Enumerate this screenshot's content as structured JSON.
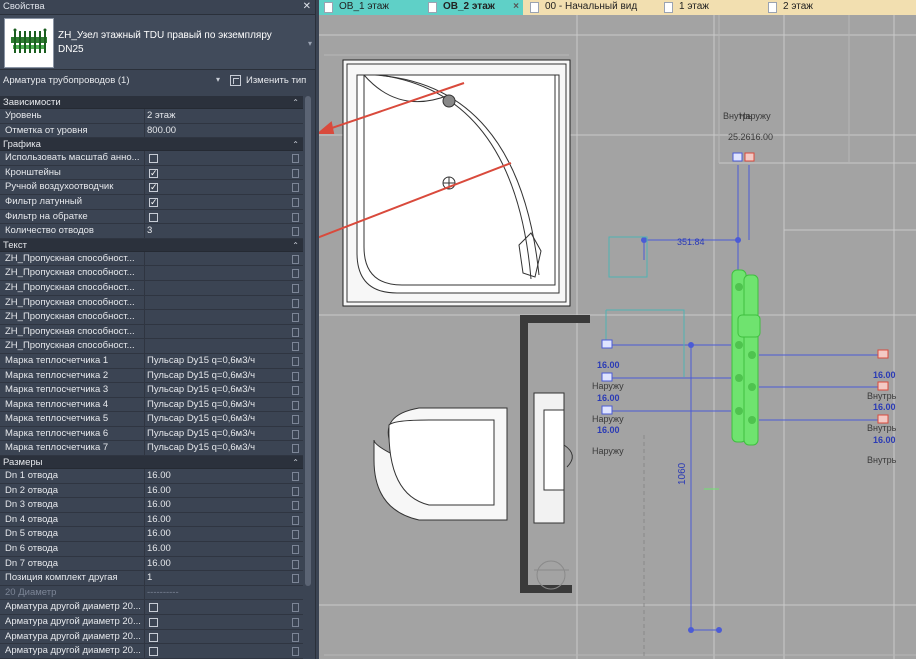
{
  "properties_panel": {
    "title": "Свойства",
    "close_glyph": "✕",
    "type_name_line1": "ZH_Узел этажный TDU правый по экземпляру",
    "type_name_line2": "DN25",
    "category_selector": "Арматура трубопроводов (1)",
    "edit_type_label": "Изменить тип",
    "sections": {
      "dependencies": {
        "title": "Зависимости",
        "rows": [
          {
            "label": "Уровень",
            "value": "2 этаж"
          },
          {
            "label": "Отметка от уровня",
            "value": "800.00"
          }
        ]
      },
      "graphics": {
        "title": "Графика",
        "rows": [
          {
            "label": "Использовать масштаб анно...",
            "checked": false
          },
          {
            "label": "Кронштейны",
            "checked": true
          },
          {
            "label": "Ручной воздухоотводчик",
            "checked": true
          },
          {
            "label": "Фильтр латунный",
            "checked": true
          },
          {
            "label": "Фильтр на обратке",
            "checked": false
          },
          {
            "label": "Количество отводов",
            "value": "3"
          }
        ]
      },
      "text": {
        "title": "Текст",
        "rows": [
          {
            "label": "ZH_Пропускная способност...",
            "value": ""
          },
          {
            "label": "ZH_Пропускная способност...",
            "value": ""
          },
          {
            "label": "ZH_Пропускная способност...",
            "value": ""
          },
          {
            "label": "ZH_Пропускная способност...",
            "value": ""
          },
          {
            "label": "ZH_Пропускная способност...",
            "value": ""
          },
          {
            "label": "ZH_Пропускная способност...",
            "value": ""
          },
          {
            "label": "ZH_Пропускная способност...",
            "value": ""
          },
          {
            "label": "Марка теплосчетчика 1",
            "value": "Пульсар Dy15 q=0,6м3/ч"
          },
          {
            "label": "Марка теплосчетчика 2",
            "value": "Пульсар Dy15 q=0,6м3/ч"
          },
          {
            "label": "Марка теплосчетчика 3",
            "value": "Пульсар Dy15 q=0,6м3/ч"
          },
          {
            "label": "Марка теплосчетчика 4",
            "value": "Пульсар Dy15 q=0,6м3/ч"
          },
          {
            "label": "Марка теплосчетчика 5",
            "value": "Пульсар Dy15 q=0,6м3/ч"
          },
          {
            "label": "Марка теплосчетчика 6",
            "value": "Пульсар Dy15 q=0,6м3/ч"
          },
          {
            "label": "Марка теплосчетчика 7",
            "value": "Пульсар Dy15 q=0,6м3/ч"
          }
        ]
      },
      "dimensions": {
        "title": "Размеры",
        "rows": [
          {
            "label": "Dn 1 отвода",
            "value": "16.00"
          },
          {
            "label": "Dn 2 отвода",
            "value": "16.00"
          },
          {
            "label": "Dn 3 отвода",
            "value": "16.00"
          },
          {
            "label": "Dn 4 отвода",
            "value": "16.00"
          },
          {
            "label": "Dn 5 отвода",
            "value": "16.00"
          },
          {
            "label": "Dn 6 отвода",
            "value": "16.00"
          },
          {
            "label": "Dn 7 отвода",
            "value": "16.00"
          },
          {
            "label": "Позиция комплект другая",
            "value": "1"
          },
          {
            "label": "20 Диаметр",
            "value": "----------"
          },
          {
            "label": "Арматура другой диаметр 20...",
            "value": ""
          },
          {
            "label": "Арматура другой диаметр 20...",
            "value": ""
          },
          {
            "label": "Арматура другой диаметр 20...",
            "value": ""
          },
          {
            "label": "Арматура другой диаметр 20...",
            "value": ""
          }
        ]
      }
    },
    "collapse_glyph": "⌃",
    "selector_arrow": "▾",
    "type_chevron": "▾"
  },
  "tabs": [
    {
      "label": "ОВ_1 этаж",
      "active": false
    },
    {
      "label": "ОВ_2 этаж",
      "active": true
    },
    {
      "label": "00 - Начальный вид",
      "active": false
    },
    {
      "label": "1 этаж",
      "active": false
    },
    {
      "label": "2 этаж",
      "active": false
    }
  ],
  "tab_close_glyph": "×",
  "viewport": {
    "dim_horizontal": "351.84",
    "dim_vertical": "1060",
    "label_inside": "Внутрь",
    "label_outside": "Наружу",
    "label_overlap": "25.2616.00",
    "pipe_dn": "16.00",
    "colors": {
      "background": "#a3a3a3",
      "pipe_blue": "#4b5bd6",
      "manifold_green": "#6fe36f",
      "arrow_red": "#d94a3c",
      "wall_dark": "#3a3a3a"
    }
  }
}
